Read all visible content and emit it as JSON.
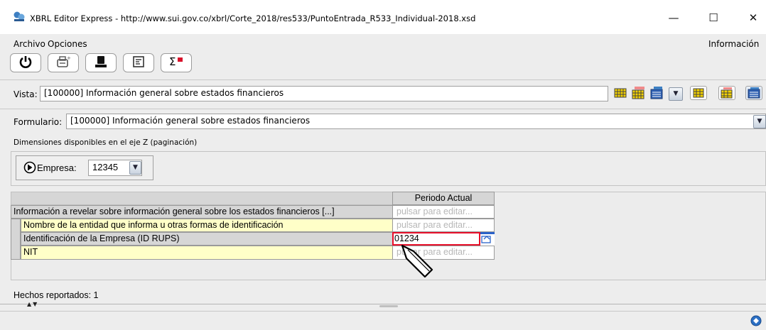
{
  "window": {
    "title": "XBRL Editor Express - http://www.sui.gov.co/xbrl/Corte_2018/res533/PuntoEntrada_R533_Individual-2018.xsd",
    "minimize": "—",
    "maximize": "☐",
    "close": "✕"
  },
  "menu": {
    "archivo": "Archivo",
    "opciones": "Opciones",
    "informacion": "Información"
  },
  "toolbar": {
    "icons": [
      "power-icon",
      "print-icon",
      "stamp-icon",
      "form-icon",
      "sum-icon"
    ]
  },
  "vista": {
    "label": "Vista:",
    "value": "[100000] Información general sobre estados financieros"
  },
  "formulario": {
    "label": "Formulario:",
    "value": "[100000] Información general sobre estados financieros"
  },
  "dimensions": {
    "heading": "Dimensiones disponibles en el eje Z (paginación)",
    "empresa_label": "Empresa:",
    "empresa_value": "12345"
  },
  "grid": {
    "column_header": "Periodo Actual",
    "rows": [
      {
        "label": "Información a revelar sobre información general sobre los estados financieros [...]",
        "value": "pulsar para editar..."
      },
      {
        "label": "Nombre de la entidad que informa u otras formas de identificación",
        "value": "pulsar para editar..."
      },
      {
        "label": "Identificación de la Empresa (ID RUPS)",
        "value": "01234"
      },
      {
        "label": "NIT",
        "value": "pulsar para editar..."
      }
    ]
  },
  "status": {
    "facts": "Hechos reportados: 1"
  },
  "colors": {
    "accent": "#e8102a",
    "yellow": "#ffffc8",
    "header": "#d6d6d6"
  }
}
